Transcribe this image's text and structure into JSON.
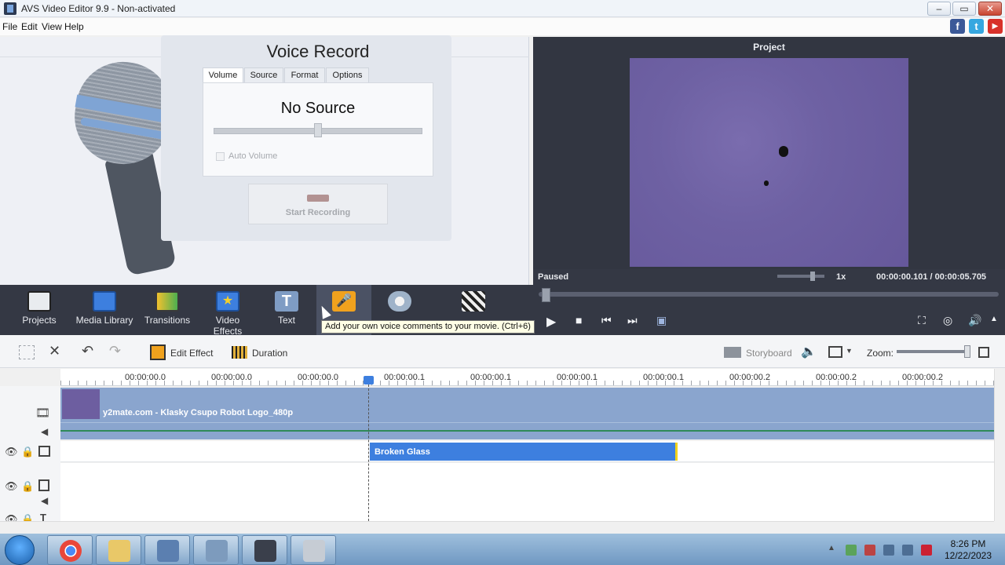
{
  "window": {
    "title": "AVS Video Editor 9.9 - Non-activated"
  },
  "menu": {
    "items": [
      "File",
      "Edit",
      "View",
      "Help"
    ]
  },
  "social": {
    "facebook": "f",
    "twitter": "t",
    "youtube": "▶"
  },
  "voice_panel": {
    "header": "Voice Record",
    "title": "Voice Record",
    "tabs": [
      "Volume",
      "Source",
      "Format",
      "Options"
    ],
    "active_tab": "Volume",
    "status": "No Source",
    "volume_level": 0.5,
    "auto_volume_label": "Auto Volume",
    "record_button": "Start Recording"
  },
  "project_panel": {
    "header": "Project",
    "state": "Paused",
    "speed": "1x",
    "time": "00:00:00.101 / 00:00:05.705"
  },
  "toolbar": {
    "tools": [
      "Projects",
      "Media Library",
      "Transitions",
      "Video Effects",
      "Text",
      "Voice",
      "Disc Menu",
      "Produce"
    ],
    "tooltip": "Add your own voice comments to your movie. (Ctrl+6)"
  },
  "timeline_toolbar": {
    "edit_effect": "Edit Effect",
    "duration": "Duration",
    "storyboard": "Storyboard",
    "zoom_label": "Zoom:"
  },
  "ruler": {
    "ticks": [
      "00:00:00.0",
      "00:00:00.0",
      "00:00:00.0",
      "00:00:00.1",
      "00:00:00.1",
      "00:00:00.1",
      "00:00:00.1",
      "00:00:00.2",
      "00:00:00.2",
      "00:00:00.2"
    ]
  },
  "tracks": {
    "video_clip": "y2mate.com - Klasky Csupo Robot Logo_480p",
    "effect_clip": "Broken Glass"
  },
  "taskbar": {
    "time": "8:26 PM",
    "date": "12/22/2023"
  }
}
